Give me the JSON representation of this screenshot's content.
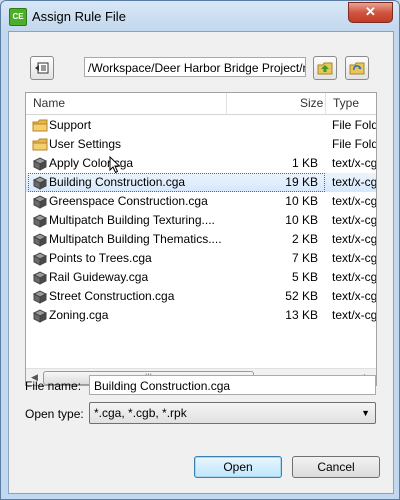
{
  "window": {
    "title": "Assign Rule File",
    "app_icon_text": "CE",
    "close_glyph": "✕"
  },
  "toolbar": {
    "path": "/Workspace/Deer Harbor Bridge Project/ru"
  },
  "list": {
    "columns": {
      "name": "Name",
      "size": "Size",
      "type": "Type"
    },
    "rows": [
      {
        "name": "Support",
        "size": "",
        "type": "File Folder",
        "icon": "folder-icon"
      },
      {
        "name": "User Settings",
        "size": "",
        "type": "File Folder",
        "icon": "folder-icon"
      },
      {
        "name": "Apply Color.cga",
        "size": "1 KB",
        "type": "text/x-cga",
        "icon": "cga-file-icon"
      },
      {
        "name": "Building Construction.cga",
        "size": "19 KB",
        "type": "text/x-cga",
        "icon": "cga-file-icon",
        "selected": true
      },
      {
        "name": "Greenspace Construction.cga",
        "size": "10 KB",
        "type": "text/x-cga",
        "icon": "cga-file-icon"
      },
      {
        "name": "Multipatch Building Texturing....",
        "size": "10 KB",
        "type": "text/x-cga",
        "icon": "cga-file-icon"
      },
      {
        "name": "Multipatch Building Thematics....",
        "size": "2 KB",
        "type": "text/x-cga",
        "icon": "cga-file-icon"
      },
      {
        "name": "Points to Trees.cga",
        "size": "7 KB",
        "type": "text/x-cga",
        "icon": "cga-file-icon"
      },
      {
        "name": "Rail Guideway.cga",
        "size": "5 KB",
        "type": "text/x-cga",
        "icon": "cga-file-icon"
      },
      {
        "name": "Street Construction.cga",
        "size": "52 KB",
        "type": "text/x-cga",
        "icon": "cga-file-icon"
      },
      {
        "name": "Zoning.cga",
        "size": "13 KB",
        "type": "text/x-cga",
        "icon": "cga-file-icon"
      }
    ]
  },
  "form": {
    "file_name_label": "File name:",
    "file_name_value": "Building Construction.cga",
    "open_type_label": "Open type:",
    "open_type_value": "*.cga, *.cgb, *.rpk"
  },
  "buttons": {
    "open": "Open",
    "cancel": "Cancel"
  },
  "colors": {
    "selection": "#d6e8fb",
    "folder": "#e8b64a",
    "accent": "#3c7fb1"
  }
}
